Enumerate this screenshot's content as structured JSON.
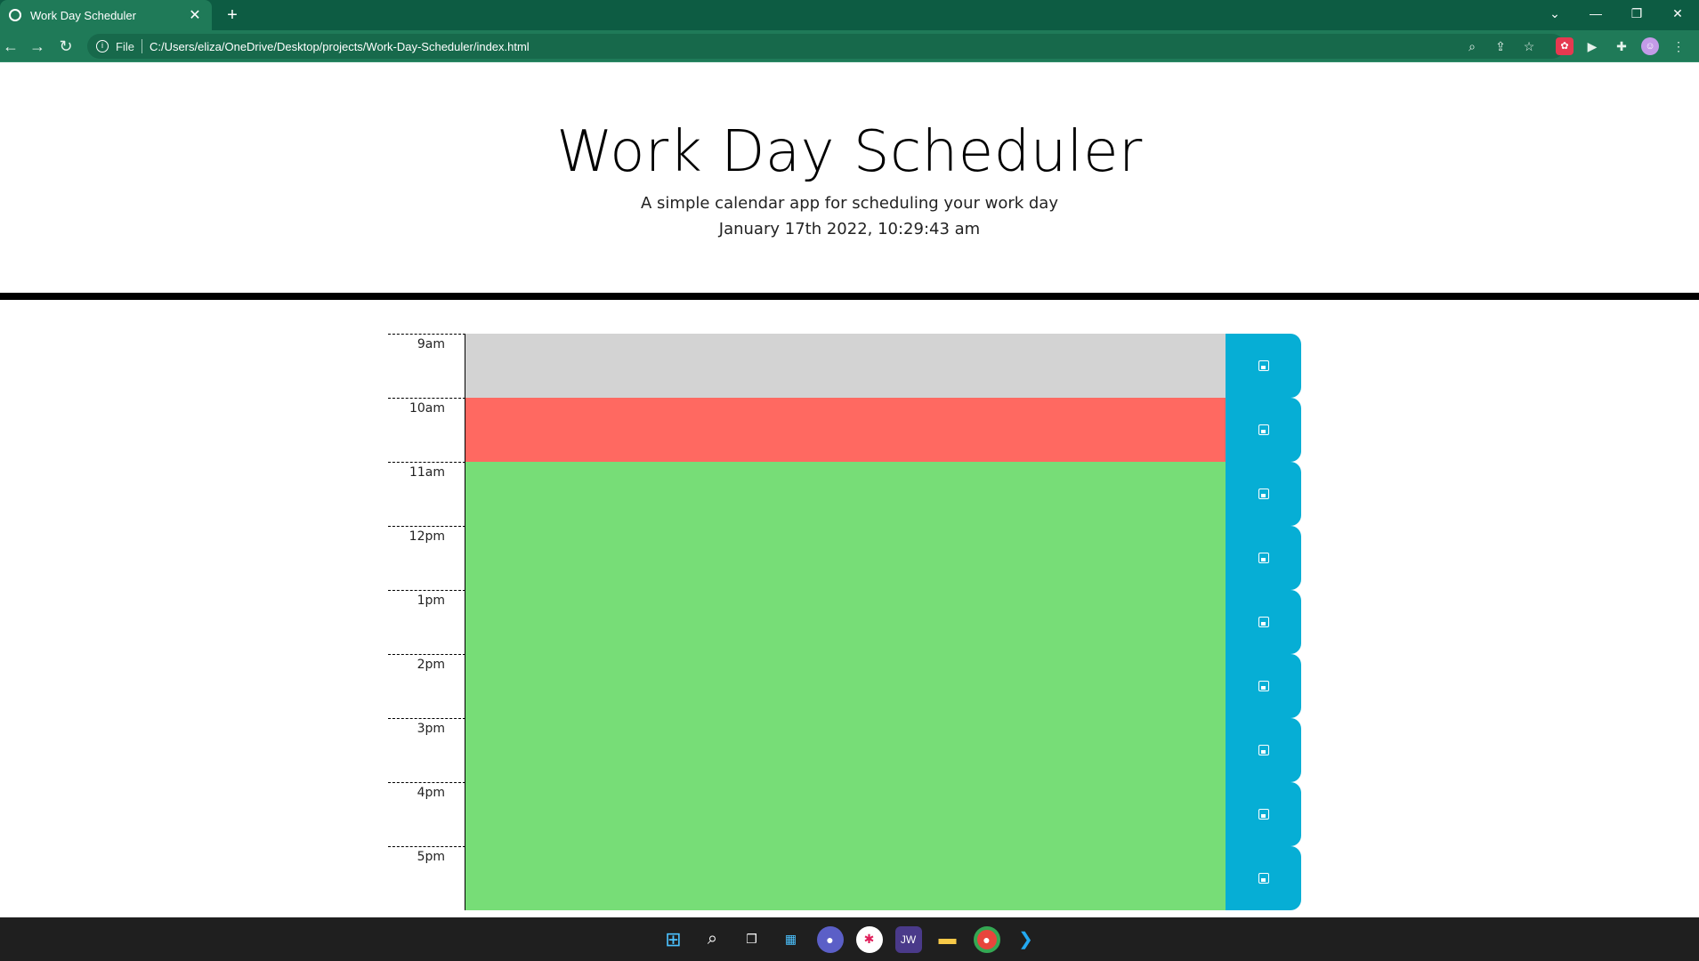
{
  "browser": {
    "tab_title": "Work Day Scheduler",
    "tab_close": "✕",
    "new_tab": "+",
    "file_label": "File",
    "url": "C:/Users/eliza/OneDrive/Desktop/projects/Work-Day-Scheduler/index.html",
    "window_controls": [
      "⌄",
      "—",
      "❐",
      "✕"
    ]
  },
  "header": {
    "title": "Work Day Scheduler",
    "lead": "A simple calendar app for scheduling your work day",
    "current_day": "January 17th 2022, 10:29:43 am"
  },
  "hours": [
    {
      "label": "9am",
      "state": "past",
      "text": ""
    },
    {
      "label": "10am",
      "state": "present",
      "text": ""
    },
    {
      "label": "11am",
      "state": "future",
      "text": ""
    },
    {
      "label": "12pm",
      "state": "future",
      "text": ""
    },
    {
      "label": "1pm",
      "state": "future",
      "text": ""
    },
    {
      "label": "2pm",
      "state": "future",
      "text": ""
    },
    {
      "label": "3pm",
      "state": "future",
      "text": ""
    },
    {
      "label": "4pm",
      "state": "future",
      "text": ""
    },
    {
      "label": "5pm",
      "state": "future",
      "text": ""
    }
  ],
  "colors": {
    "past": "#d3d3d3",
    "present": "#ff6961",
    "future": "#77dd77",
    "save": "#06aed5",
    "browser_chrome": "#1f7a58"
  },
  "taskbar_icons": [
    "windows-start-icon",
    "search-icon",
    "task-view-icon",
    "widgets-icon",
    "chat-icon",
    "slack-icon",
    "jw-icon",
    "file-explorer-icon",
    "chrome-icon",
    "vscode-icon"
  ],
  "taskbar_labels": {
    "jw": "JW"
  }
}
